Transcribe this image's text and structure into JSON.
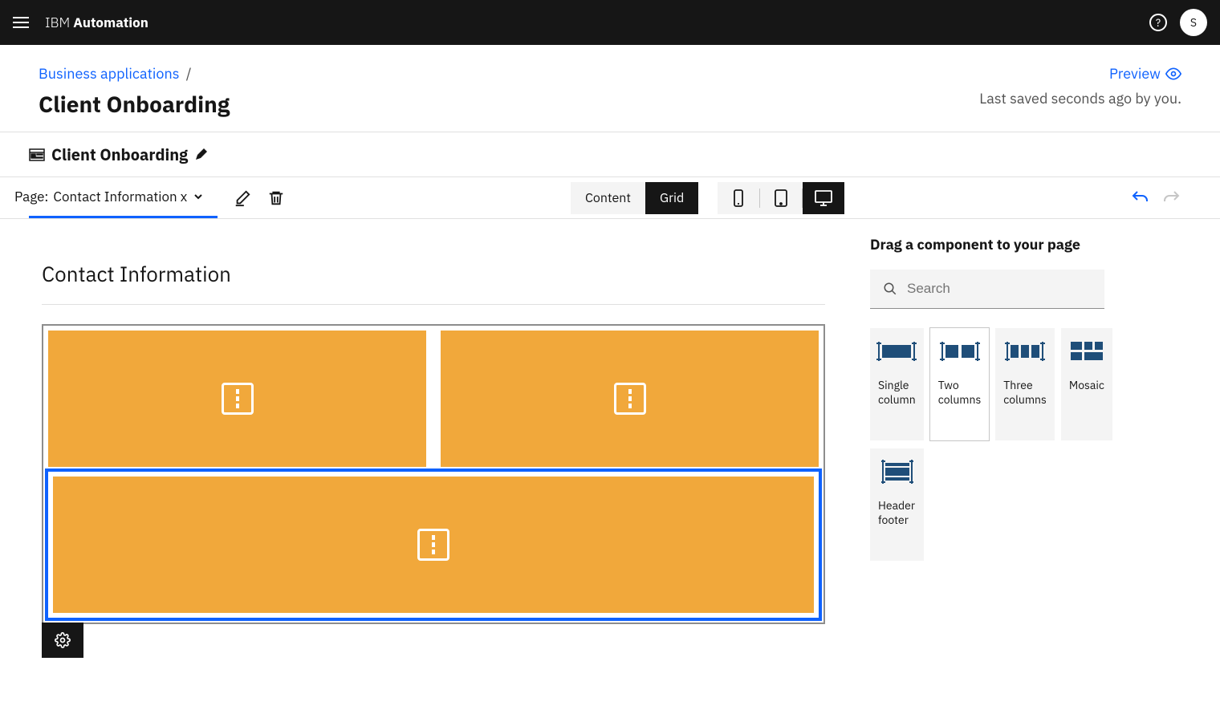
{
  "header": {
    "brand_prefix": "IBM ",
    "brand_bold": "Automation",
    "avatar_initial": "S"
  },
  "subheader": {
    "breadcrumb_link": "Business applications",
    "breadcrumb_sep": "/",
    "title": "Client Onboarding",
    "preview_label": "Preview",
    "last_saved": "Last saved seconds ago by you."
  },
  "app_row": {
    "name": "Client Onboarding"
  },
  "toolbar": {
    "page_label": "Page:",
    "page_value": "Contact Information x",
    "content_btn": "Content",
    "grid_btn": "Grid"
  },
  "canvas": {
    "title": "Contact Information"
  },
  "sidepanel": {
    "title": "Drag a component to your page",
    "search_placeholder": "Search",
    "components": [
      {
        "label": "Single column"
      },
      {
        "label": "Two columns"
      },
      {
        "label": "Three columns"
      },
      {
        "label": "Mosaic"
      },
      {
        "label": "Header footer"
      }
    ]
  }
}
